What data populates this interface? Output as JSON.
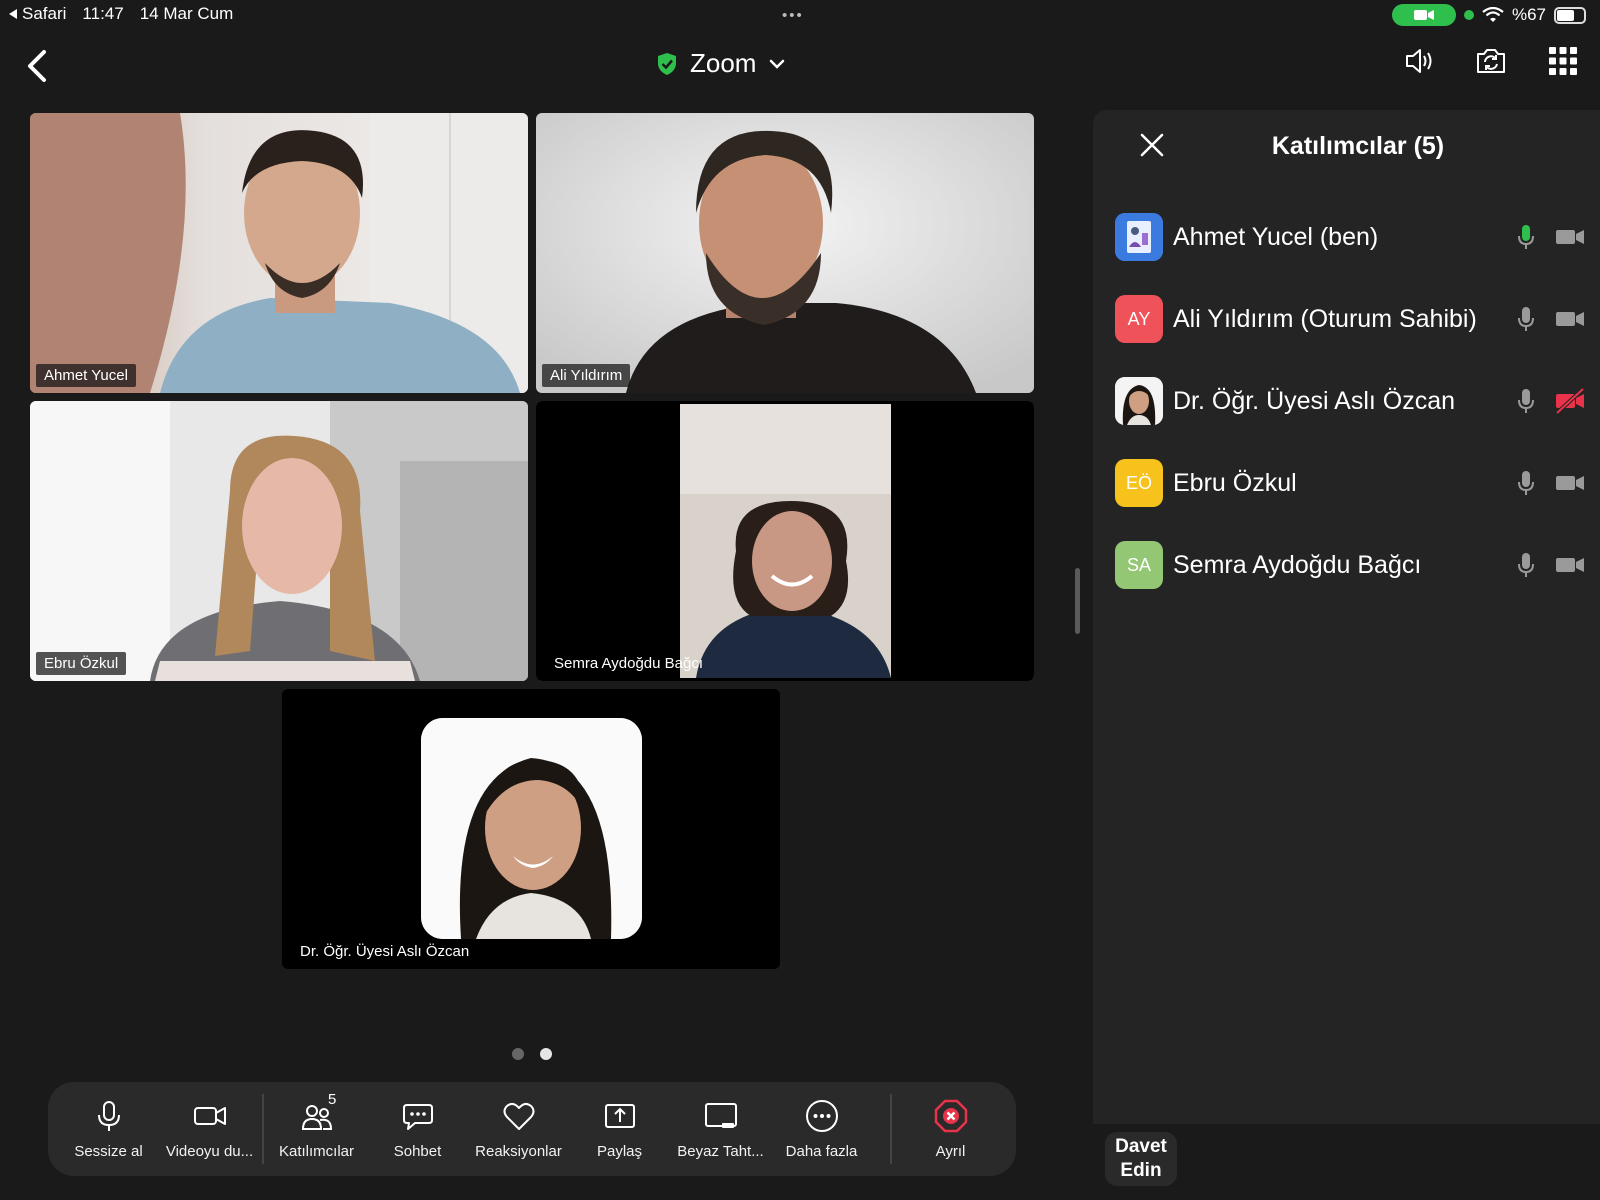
{
  "status_bar": {
    "back_app": "Safari",
    "time": "11:47",
    "date": "14 Mar Cum",
    "dots": "•••",
    "battery": "%67"
  },
  "nav": {
    "title": "Zoom"
  },
  "tiles": [
    {
      "name": "Ahmet Yucel"
    },
    {
      "name": "Ali Yıldırım"
    },
    {
      "name": "Ebru Özkul"
    },
    {
      "name": "Semra Aydoğdu Bağcı"
    },
    {
      "name": "Dr. Öğr. Üyesi Aslı Özcan"
    }
  ],
  "toolbar": {
    "mute": "Sessize al",
    "video": "Videoyu du...",
    "participants": "Katılımcılar",
    "participants_count": "5",
    "chat": "Sohbet",
    "reactions": "Reaksiyonlar",
    "share": "Paylaş",
    "whiteboard": "Beyaz Taht...",
    "more": "Daha fazla",
    "leave": "Ayrıl"
  },
  "panel": {
    "title": "Katılımcılar (5)",
    "participants": [
      {
        "name": "Ahmet Yucel (ben)",
        "initials": "",
        "avatar_color": "#3b7be0",
        "mic": "active",
        "video": "on"
      },
      {
        "name": "Ali Yıldırım (Oturum Sahibi)",
        "initials": "AY",
        "avatar_color": "#f0525a",
        "mic": "idle",
        "video": "on"
      },
      {
        "name": "Dr. Öğr. Üyesi Aslı Özcan",
        "initials": "",
        "avatar_color": "#ffffff",
        "mic": "idle",
        "video": "off"
      },
      {
        "name": "Ebru Özkul",
        "initials": "EÖ",
        "avatar_color": "#f6c21b",
        "mic": "idle",
        "video": "on"
      },
      {
        "name": "Semra Aydoğdu Bağcı",
        "initials": "SA",
        "avatar_color": "#93c774",
        "mic": "idle",
        "video": "on"
      }
    ],
    "invite": "Davet Edin"
  },
  "colors": {
    "accent_green": "#2fd66a",
    "leave_red": "#e8334a"
  }
}
